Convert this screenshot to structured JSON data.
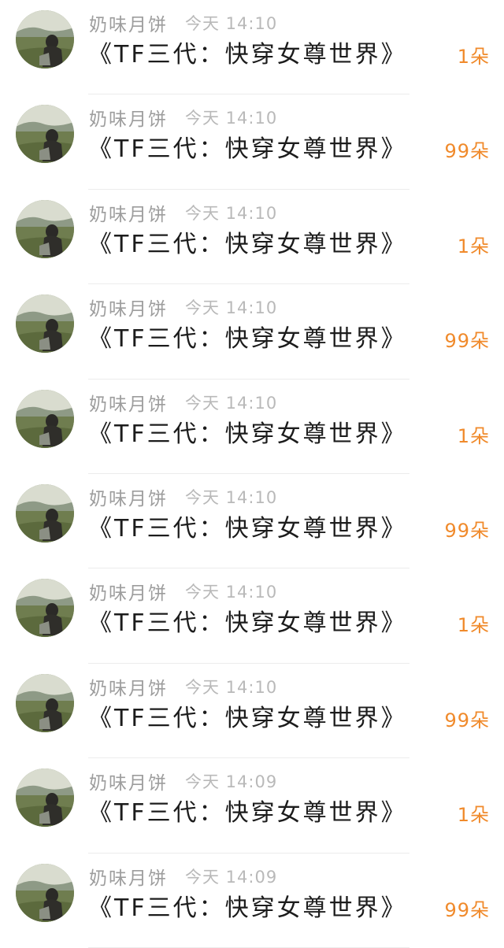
{
  "messages": [
    {
      "name": "奶味月饼",
      "time": "今天 14:10",
      "text": "《TF三代：快穿女尊世界》",
      "gift": "1朵"
    },
    {
      "name": "奶味月饼",
      "time": "今天 14:10",
      "text": "《TF三代：快穿女尊世界》",
      "gift": "99朵"
    },
    {
      "name": "奶味月饼",
      "time": "今天 14:10",
      "text": "《TF三代：快穿女尊世界》",
      "gift": "1朵"
    },
    {
      "name": "奶味月饼",
      "time": "今天 14:10",
      "text": "《TF三代：快穿女尊世界》",
      "gift": "99朵"
    },
    {
      "name": "奶味月饼",
      "time": "今天 14:10",
      "text": "《TF三代：快穿女尊世界》",
      "gift": "1朵"
    },
    {
      "name": "奶味月饼",
      "time": "今天 14:10",
      "text": "《TF三代：快穿女尊世界》",
      "gift": "99朵"
    },
    {
      "name": "奶味月饼",
      "time": "今天 14:10",
      "text": "《TF三代：快穿女尊世界》",
      "gift": "1朵"
    },
    {
      "name": "奶味月饼",
      "time": "今天 14:10",
      "text": "《TF三代：快穿女尊世界》",
      "gift": "99朵"
    },
    {
      "name": "奶味月饼",
      "time": "今天 14:09",
      "text": "《TF三代：快穿女尊世界》",
      "gift": "1朵"
    },
    {
      "name": "奶味月饼",
      "time": "今天 14:09",
      "text": "《TF三代：快穿女尊世界》",
      "gift": "99朵"
    }
  ],
  "colors": {
    "name": "#9d9d9d",
    "time": "#b9b9b9",
    "text": "#1c1c1c",
    "gift": "#f08a2b"
  },
  "avatar_icon": "user-photo-avatar"
}
